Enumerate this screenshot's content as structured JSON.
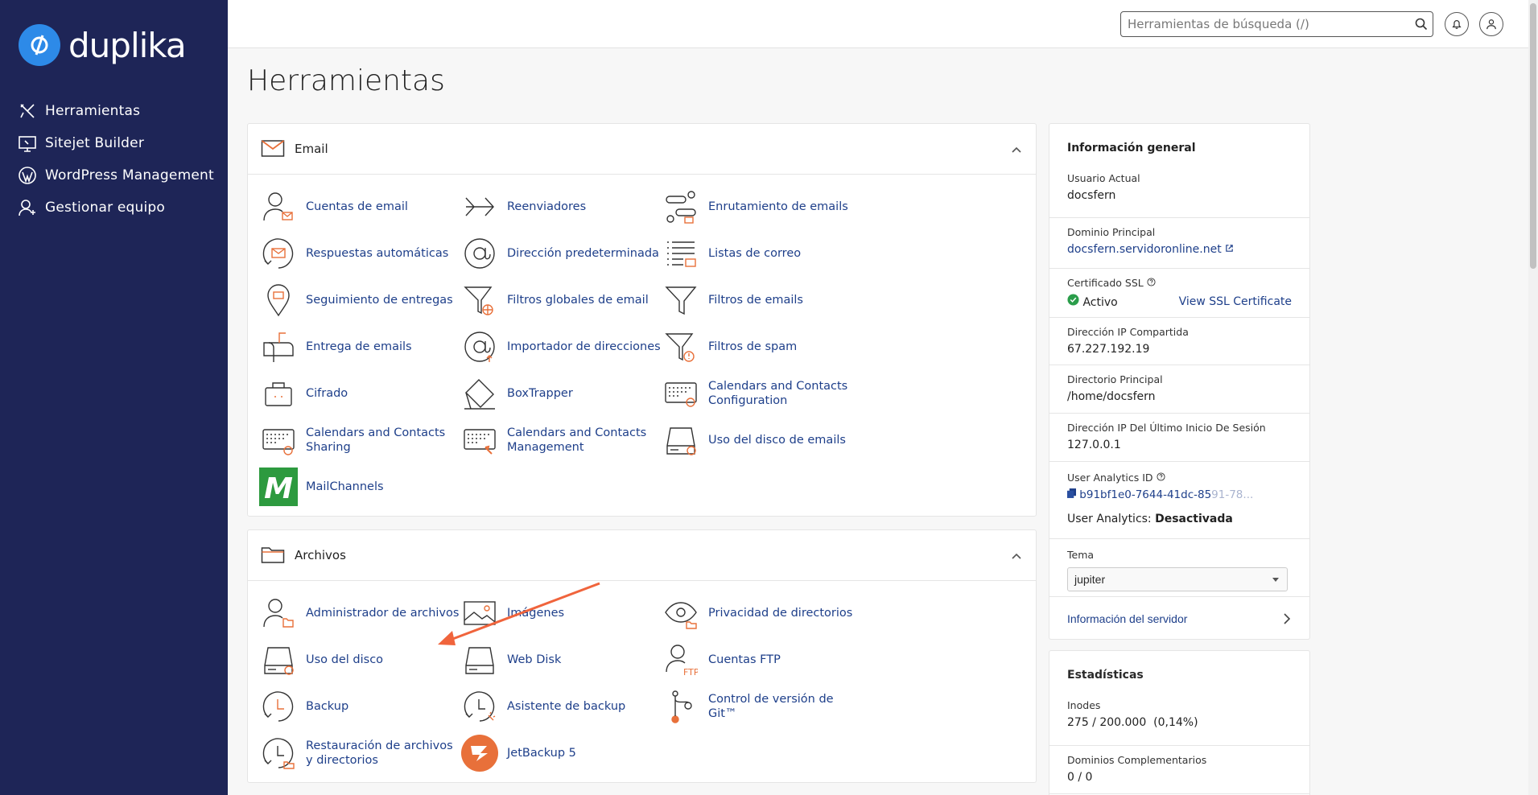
{
  "brand": {
    "name": "duplika"
  },
  "sidebar": {
    "items": [
      {
        "label": "Herramientas",
        "icon": "tools-icon"
      },
      {
        "label": "Sitejet Builder",
        "icon": "sitejet-icon"
      },
      {
        "label": "WordPress Management",
        "icon": "wordpress-icon"
      },
      {
        "label": "Gestionar equipo",
        "icon": "user-add-icon"
      }
    ]
  },
  "topbar": {
    "search_placeholder": "Herramientas de búsqueda (/)"
  },
  "page": {
    "title": "Herramientas"
  },
  "email": {
    "title": "Email",
    "tools": [
      {
        "label": "Cuentas de email",
        "icon": "email-accounts-icon"
      },
      {
        "label": "Reenviadores",
        "icon": "forwarders-icon"
      },
      {
        "label": "Enrutamiento de emails",
        "icon": "email-routing-icon"
      },
      {
        "label": "Respuestas automáticas",
        "icon": "autoresponders-icon"
      },
      {
        "label": "Dirección predeterminada",
        "icon": "default-address-icon"
      },
      {
        "label": "Listas de correo",
        "icon": "mailing-lists-icon"
      },
      {
        "label": "Seguimiento de entregas",
        "icon": "track-delivery-icon"
      },
      {
        "label": "Filtros globales de email",
        "icon": "global-filters-icon"
      },
      {
        "label": "Filtros de emails",
        "icon": "email-filters-icon"
      },
      {
        "label": "Entrega de emails",
        "icon": "email-delivery-icon"
      },
      {
        "label": "Importador de direcciones",
        "icon": "address-importer-icon"
      },
      {
        "label": "Filtros de spam",
        "icon": "spam-filters-icon"
      },
      {
        "label": "Cifrado",
        "icon": "encryption-icon"
      },
      {
        "label": "BoxTrapper",
        "icon": "boxtrapper-icon"
      },
      {
        "label": "Calendars and Contacts Configuration",
        "icon": "calendars-config-icon"
      },
      {
        "label": "Calendars and Contacts Sharing",
        "icon": "calendars-sharing-icon"
      },
      {
        "label": "Calendars and Contacts Management",
        "icon": "calendars-management-icon"
      },
      {
        "label": "Uso del disco de emails",
        "icon": "email-disk-usage-icon"
      },
      {
        "label": "MailChannels",
        "icon": "mailchannels-icon"
      }
    ]
  },
  "files": {
    "title": "Archivos",
    "tools": [
      {
        "label": "Administrador de archivos",
        "icon": "file-manager-icon"
      },
      {
        "label": "Imágenes",
        "icon": "images-icon"
      },
      {
        "label": "Privacidad de directorios",
        "icon": "directory-privacy-icon"
      },
      {
        "label": "Uso del disco",
        "icon": "disk-usage-icon"
      },
      {
        "label": "Web Disk",
        "icon": "web-disk-icon"
      },
      {
        "label": "Cuentas FTP",
        "icon": "ftp-accounts-icon"
      },
      {
        "label": "Backup",
        "icon": "backup-icon"
      },
      {
        "label": "Asistente de backup",
        "icon": "backup-wizard-icon"
      },
      {
        "label": "Control de versión de Git™",
        "icon": "git-icon"
      },
      {
        "label": "Restauración de archivos y directorios",
        "icon": "file-restore-icon"
      },
      {
        "label": "JetBackup 5",
        "icon": "jetbackup-icon"
      }
    ]
  },
  "info": {
    "title": "Información general",
    "current_user_label": "Usuario Actual",
    "current_user": "docsfern",
    "domain_label": "Dominio Principal",
    "domain": "docsfern.servidoronline.net",
    "ssl_label": "Certificado SSL",
    "ssl_status": "Activo",
    "ssl_link": "View SSL Certificate",
    "shared_ip_label": "Dirección IP Compartida",
    "shared_ip": "67.227.192.19",
    "home_label": "Directorio Principal",
    "home": "/home/docsfern",
    "last_ip_label": "Dirección IP Del Último Inicio De Sesión",
    "last_ip": "127.0.0.1",
    "analytics_label": "User Analytics ID",
    "analytics_id": "b91bf1e0-7644-41dc-85",
    "analytics_id_faded": "91-78...",
    "analytics_status_label": "User Analytics:",
    "analytics_status": "Desactivada",
    "theme_label": "Tema",
    "theme": "jupiter",
    "server_info": "Información del servidor"
  },
  "stats": {
    "title": "Estadísticas",
    "inodes_label": "Inodes",
    "inodes": "275 / 200.000",
    "inodes_pct": "(0,14%)",
    "addon_label": "Dominios Complementarios",
    "addon": "0 / 0"
  },
  "colors": {
    "sidebar": "#1e2557",
    "accent": "#e8703a",
    "link": "#1e3f8a",
    "brand": "#2d8ae8"
  }
}
